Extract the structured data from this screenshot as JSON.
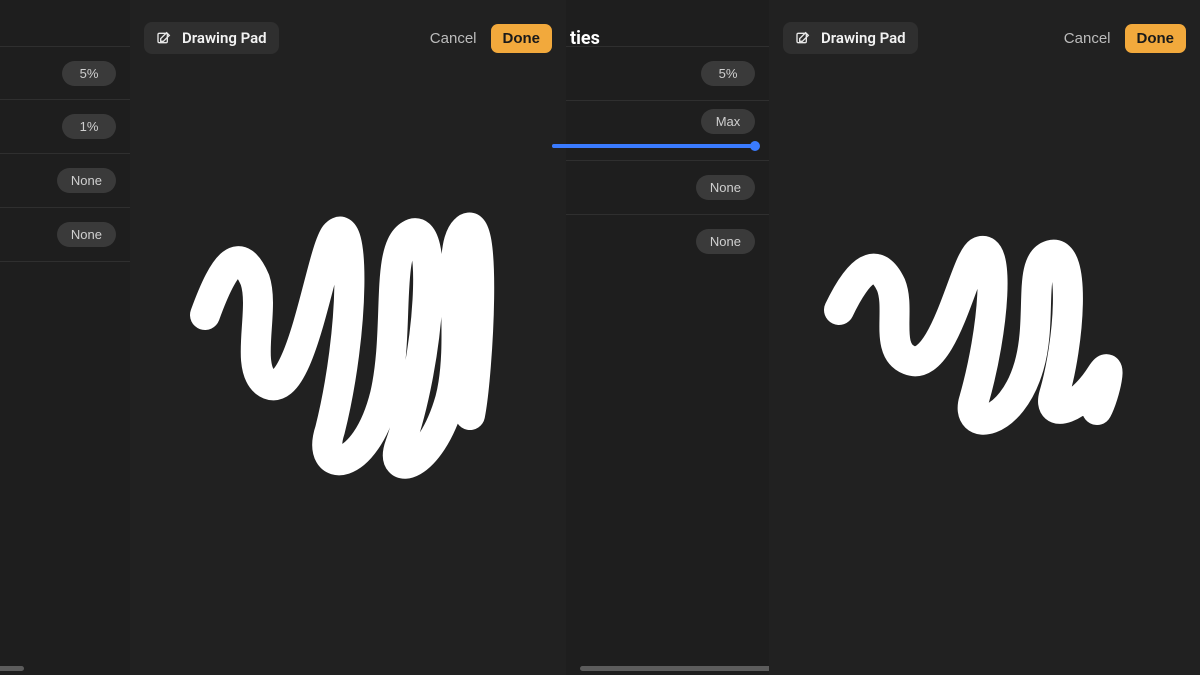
{
  "left_props": {
    "rows": [
      {
        "value": "5%"
      },
      {
        "value": "1%"
      },
      {
        "value": "None"
      },
      {
        "value": "None"
      }
    ]
  },
  "mid_props": {
    "heading_fragment": "ties",
    "rows": [
      {
        "value": "5%",
        "slider": false
      },
      {
        "value": "Max",
        "slider": true,
        "percent": 100
      },
      {
        "value": "None",
        "slider": false
      },
      {
        "value": "None",
        "slider": false
      }
    ]
  },
  "modal_left": {
    "title": "Drawing Pad",
    "cancel_label": "Cancel",
    "done_label": "Done"
  },
  "modal_right": {
    "title": "Drawing Pad",
    "cancel_label": "Cancel",
    "done_label": "Done"
  },
  "colors": {
    "accent": "#f2a93c",
    "slider": "#3a7bff",
    "stroke": "#ffffff"
  }
}
